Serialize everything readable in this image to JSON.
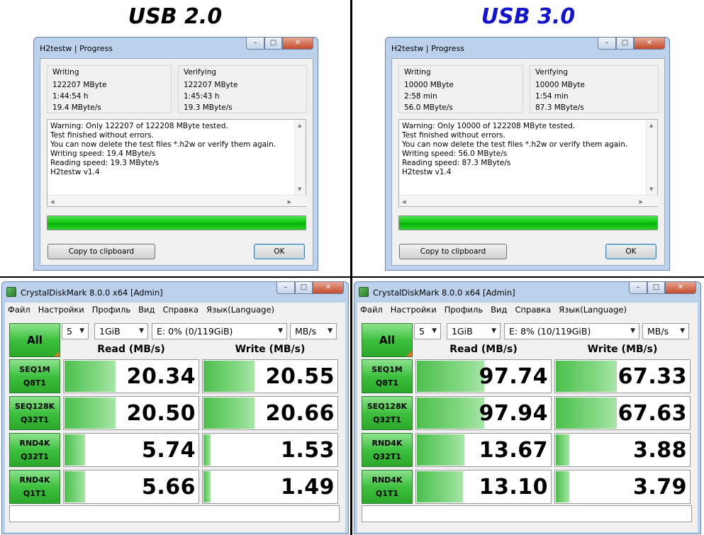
{
  "left": {
    "heading": "USB 2.0",
    "heading_color": "#000000",
    "h2w": {
      "title": "H2testw | Progress",
      "writing": {
        "label": "Writing",
        "size": "122207 MByte",
        "time": "1:44:54 h",
        "speed": "19.4 MByte/s"
      },
      "verifying": {
        "label": "Verifying",
        "size": "122207 MByte",
        "time": "1:45:43 h",
        "speed": "19.3 MByte/s"
      },
      "log": [
        "Warning: Only 122207 of 122208 MByte tested.",
        "Test finished without errors.",
        "You can now delete the test files *.h2w or verify them again.",
        "Writing speed: 19.4 MByte/s",
        "Reading speed: 19.3 MByte/s",
        "H2testw v1.4"
      ],
      "progress": 1.0,
      "copy_label": "Copy to clipboard",
      "ok_label": "OK"
    },
    "cdm": {
      "title": "CrystalDiskMark 8.0.0 x64 [Admin]",
      "menu": [
        "Файл",
        "Настройки",
        "Профиль",
        "Вид",
        "Справка",
        "Язык(Language)"
      ],
      "all_label": "All",
      "count": "5",
      "size": "1GiB",
      "drive": "E: 0% (0/119GiB)",
      "unit": "MB/s",
      "read_header": "Read (MB/s)",
      "write_header": "Write (MB/s)",
      "rows": [
        {
          "l1": "SEQ1M",
          "l2": "Q8T1",
          "read": "20.34",
          "write": "20.55",
          "rfill": 0.38,
          "wfill": 0.38
        },
        {
          "l1": "SEQ128K",
          "l2": "Q32T1",
          "read": "20.50",
          "write": "20.66",
          "rfill": 0.38,
          "wfill": 0.38
        },
        {
          "l1": "RND4K",
          "l2": "Q32T1",
          "read": "5.74",
          "write": "1.53",
          "rfill": 0.15,
          "wfill": 0.05
        },
        {
          "l1": "RND4K",
          "l2": "Q1T1",
          "read": "5.66",
          "write": "1.49",
          "rfill": 0.15,
          "wfill": 0.05
        }
      ],
      "status": ""
    }
  },
  "right": {
    "heading": "USB 3.0",
    "heading_color": "#1414c8",
    "h2w": {
      "title": "H2testw | Progress",
      "writing": {
        "label": "Writing",
        "size": "10000 MByte",
        "time": "2:58 min",
        "speed": "56.0 MByte/s"
      },
      "verifying": {
        "label": "Verifying",
        "size": "10000 MByte",
        "time": "1:54 min",
        "speed": "87.3 MByte/s"
      },
      "log": [
        "Warning: Only 10000 of 122208 MByte tested.",
        "Test finished without errors.",
        "You can now delete the test files *.h2w or verify them again.",
        "Writing speed: 56.0 MByte/s",
        "Reading speed: 87.3 MByte/s",
        "H2testw v1.4"
      ],
      "progress": 1.0,
      "copy_label": "Copy to clipboard",
      "ok_label": "OK"
    },
    "cdm": {
      "title": "CrystalDiskMark 8.0.0 x64 [Admin]",
      "menu": [
        "Файл",
        "Настройки",
        "Профиль",
        "Вид",
        "Справка",
        "Язык(Language)"
      ],
      "all_label": "All",
      "count": "5",
      "size": "1GiB",
      "drive": "E: 8% (10/119GiB)",
      "unit": "MB/s",
      "read_header": "Read (MB/s)",
      "write_header": "Write (MB/s)",
      "rows": [
        {
          "l1": "SEQ1M",
          "l2": "Q8T1",
          "read": "97.74",
          "write": "67.33",
          "rfill": 0.5,
          "wfill": 0.45
        },
        {
          "l1": "SEQ128K",
          "l2": "Q32T1",
          "read": "97.94",
          "write": "67.63",
          "rfill": 0.5,
          "wfill": 0.45
        },
        {
          "l1": "RND4K",
          "l2": "Q32T1",
          "read": "13.67",
          "write": "3.88",
          "rfill": 0.35,
          "wfill": 0.1
        },
        {
          "l1": "RND4K",
          "l2": "Q1T1",
          "read": "13.10",
          "write": "3.79",
          "rfill": 0.34,
          "wfill": 0.1
        }
      ],
      "status": ""
    }
  }
}
